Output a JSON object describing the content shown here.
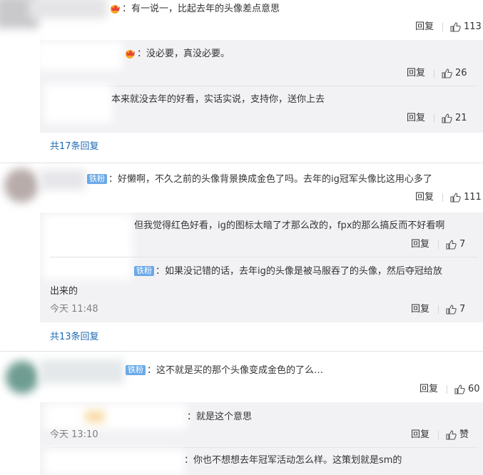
{
  "c1": {
    "text": "：有一说一，比起去年的头像差点意思",
    "reply_label": "回复",
    "likes": "113",
    "subs": [
      {
        "text": "：没必要，真没必要。",
        "reply_label": "回复",
        "likes": "26"
      },
      {
        "text": "本来就没去年的好看，实话实说，支持你，送你上去",
        "reply_label": "回复",
        "likes": "21"
      }
    ],
    "more": "共17条回复"
  },
  "c2": {
    "badge": "铁粉",
    "text": "：好懒啊，不久之前的头像背景换成金色了吗。去年的ig冠军头像比这用心多了",
    "reply_label": "回复",
    "likes": "111",
    "subs": [
      {
        "text": "但我觉得红色好看，ig的图标太暗了才那么改的，fpx的那么搞反而不好看啊",
        "reply_label": "回复",
        "likes": "7"
      },
      {
        "badge": "铁粉",
        "text": "：如果没记错的话，去年ig的头像是被马服吞了的头像，然后夺冠给放",
        "text2": "出来的",
        "time": "今天 11:48",
        "reply_label": "回复",
        "likes": "7"
      }
    ],
    "more": "共13条回复"
  },
  "c3": {
    "badge": "铁粉",
    "text": "：这不就是买的那个头像变成金色的了么…",
    "reply_label": "回复",
    "likes": "60",
    "subs": [
      {
        "text": "：就是这个意思",
        "time": "今天 13:10",
        "reply_label": "回复",
        "likes": "赞"
      },
      {
        "text": "：你也不想想去年冠军活动怎么样。这策划就是sm的"
      }
    ]
  },
  "colors": {
    "link": "#1f6bb5",
    "badge": "#6aa9e8",
    "sub_bg": "#f2f2f5"
  }
}
